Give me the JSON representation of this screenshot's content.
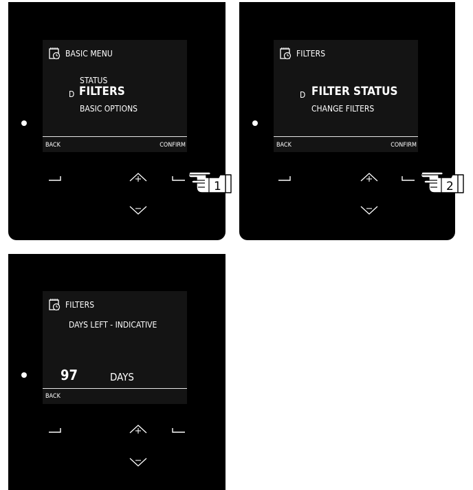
{
  "panel1": {
    "title": "BASIC MENU",
    "items": [
      "STATUS",
      "FILTERS",
      "BASIC OPTIONS"
    ],
    "cursor": "D",
    "back_label": "BACK",
    "confirm_label": "CONFIRM",
    "step_label": "1"
  },
  "panel2": {
    "title": "FILTERS",
    "items": [
      "FILTER STATUS",
      "CHANGE FILTERS"
    ],
    "cursor": "D",
    "back_label": "BACK",
    "confirm_label": "CONFIRM",
    "step_label": "2"
  },
  "panel3": {
    "title": "FILTERS",
    "subtitle": "DAYS LEFT - INDICATIVE",
    "days_value": "97",
    "days_unit": "DAYS",
    "back_label": "BACK"
  },
  "icons": {
    "menu": "calendar-clock-icon",
    "up": "up-plus-icon",
    "down": "down-minus-icon",
    "left": "left-softkey-icon",
    "right": "right-softkey-icon",
    "hand": "pointing-hand-icon"
  },
  "colors": {
    "panel": "#000000",
    "screen": "#141414",
    "text": "#ffffff"
  }
}
